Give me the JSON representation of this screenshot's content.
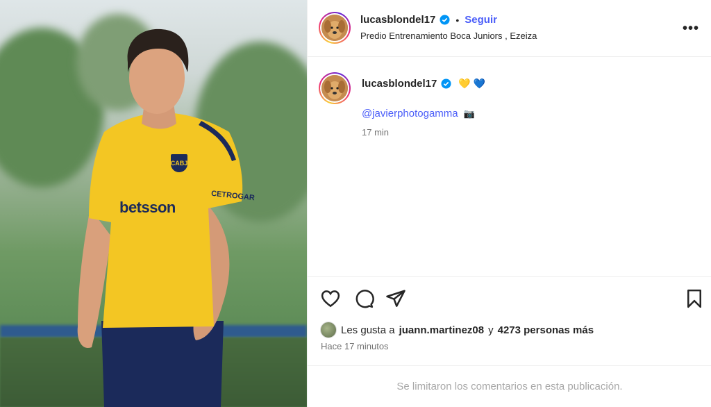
{
  "post": {
    "author": {
      "username": "lucasblondel17",
      "verified": true,
      "follow_label": "Seguir",
      "separator": "•",
      "location": "Predio Entrenamiento Boca Juniors , Ezeiza"
    },
    "more_label": "•••",
    "caption": {
      "username": "lucasblondel17",
      "emojis": "💛 💙",
      "mention": "@javierphotogamma",
      "mention_emoji": "📷",
      "time": "17 min"
    },
    "image": {
      "jersey_text": "betsson",
      "crest_text": "CABJ",
      "sleeve_text": "CETROGAR"
    },
    "likes": {
      "prefix": "Les gusta a",
      "first_user": "juann.martinez08",
      "connector": "y",
      "others": "4273 personas más"
    },
    "posted_ago": "Hace 17 minutos",
    "comments_notice": "Se limitaron los comentarios en esta publicación."
  },
  "icons": [
    "heart-icon",
    "comment-icon",
    "share-icon",
    "bookmark-icon",
    "verified-icon",
    "more-icon"
  ],
  "colors": {
    "link": "#4a5df9",
    "verified": "#0095f6",
    "text": "#262626",
    "muted": "#737373",
    "jersey": "#f3c623",
    "shorts": "#1b2a5a"
  }
}
